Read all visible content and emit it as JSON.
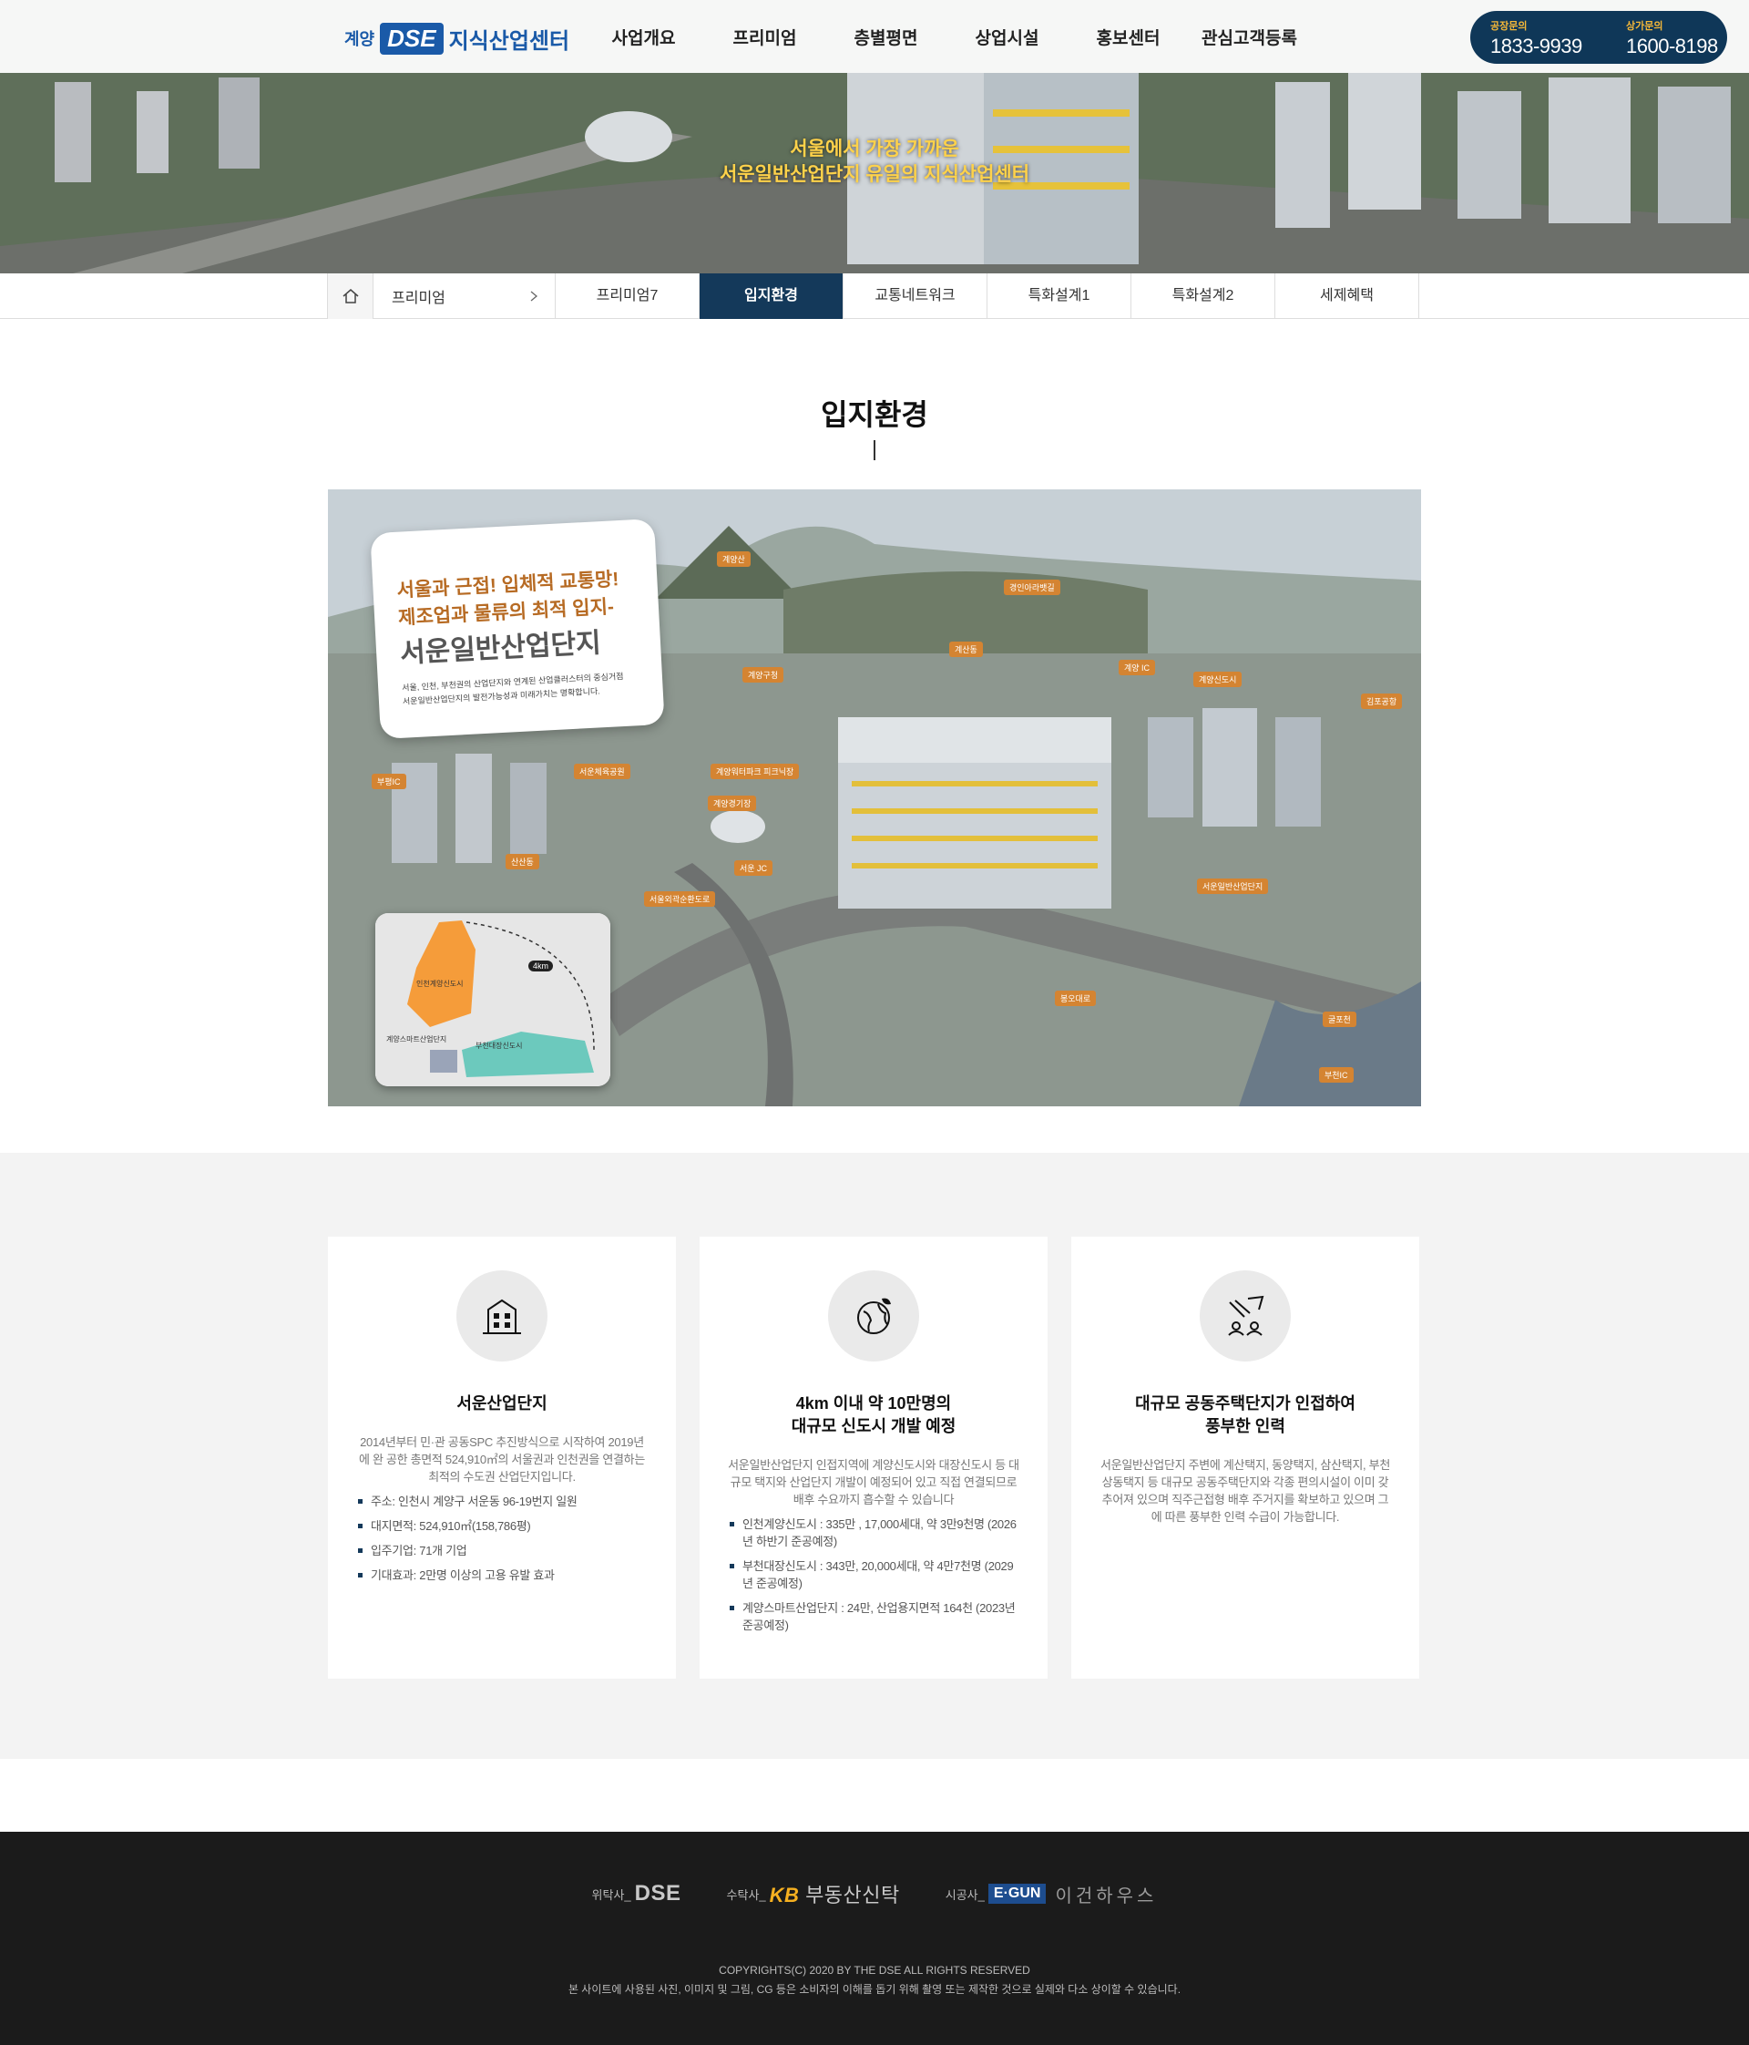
{
  "header": {
    "logo_prefix": "계양",
    "logo_brand": "DSE",
    "logo_name": "지식산업센터",
    "nav": [
      "사업개요",
      "프리미엄",
      "층별평면",
      "상업시설",
      "홍보센터",
      "관심고객등록"
    ],
    "calls": [
      {
        "label": "공장문의",
        "number": "1833-9939"
      },
      {
        "label": "상가문의",
        "number": "1600-8198"
      }
    ],
    "hero_line1": "서울에서 가장 가까운",
    "hero_line2": "서운일반산업단지 유일의 지식산업센터"
  },
  "subnav": {
    "depth1": "프리미엄",
    "tabs": [
      "프리미엄7",
      "입지환경",
      "교통네트워크",
      "특화설계1",
      "특화설계2",
      "세제혜택"
    ],
    "active_index": 1
  },
  "section": {
    "title": "입지환경"
  },
  "map": {
    "card_line1": "서울과 근접! 입체적 교통망!",
    "card_line2": "제조업과 물류의 최적 입지-",
    "card_line3": "서운일반산업단지",
    "card_desc1": "서울, 인천, 부천권의 산업단지와 연계된 산업클러스터의 중심거점",
    "card_desc2": "서운일반산업단지의 발전가능성과 미래가치는 명확합니다.",
    "pins": [
      "계양산",
      "경인아라뱃길",
      "계산동",
      "계양구청",
      "계양 IC",
      "계양신도시",
      "김포공항",
      "부평IC",
      "서운체육공원",
      "계양워터파크 피크닉장",
      "계양경기장",
      "서운 JC",
      "산산동",
      "서울외곽순환도로",
      "서운일반산업단지",
      "봉오대로",
      "굴포천",
      "부천IC"
    ],
    "mini_km": "4km",
    "mini_label1": "인천계양신도시",
    "mini_label2": "계양스마트산업단지",
    "mini_label3": "부천대장신도시"
  },
  "cards": [
    {
      "title_lines": [
        "서운산업단지"
      ],
      "body": "2014년부터 민·관 공동SPC 추진방식으로 시작하여 2019년에 완 공한 총면적 524,910㎡의 서울권과 인천권을 연결하는 최적의 수도권 산업단지입니다.",
      "bullets": [
        "주소: 인천시 계양구 서운동 96-19번지 일원",
        "대지면적: 524,910㎡(158,786평)",
        "입주기업: 71개 기업",
        "기대효과: 2만명 이상의 고용 유발 효과"
      ]
    },
    {
      "title_lines": [
        "4km 이내 약 10만명의",
        "대규모 신도시 개발 예정"
      ],
      "body": "서운일반산업단지 인접지역에 계양신도시와 대장신도시 등 대규모 택지와 산업단지 개발이 예정되어 있고 직접 연결되므로 배후 수요까지 흡수할 수 있습니다",
      "bullets": [
        "인천계양신도시 : 335만 , 17,000세대, 약 3만9천명 (2026년 하반기 준공예정)",
        "부천대장신도시 : 343만, 20,000세대, 약 4만7천명 (2029년 준공예정)",
        "계양스마트산업단지 : 24만, 산업용지면적 164천 (2023년 준공예정)"
      ]
    },
    {
      "title_lines": [
        "대규모 공동주택단지가 인접하여",
        "풍부한 인력"
      ],
      "body": "서운일반산업단지 주변에 계산택지, 동양택지, 삼산택지, 부천 상동택지 등 대규모 공동주택단지와 각종 편의시설이 이미 갖추어져 있으며 직주근접형 배후 주거지를 확보하고 있으며 그에 따른 풍부한 인력 수급이 가능합니다.",
      "bullets": []
    }
  ],
  "footer": {
    "partners": [
      {
        "role": "위탁사_",
        "name": "DSE"
      },
      {
        "role": "수탁사_",
        "mark": "KB",
        "name": "부동산신탁"
      },
      {
        "role": "시공사_",
        "mark": "E·GUN",
        "name": "이건하우스"
      }
    ],
    "copyright": "COPYRIGHTS(C) 2020 BY THE DSE ALL RIGHTS RESERVED",
    "disclaimer": "본 사이트에 사용된 사진, 이미지 및 그림, CG 등은 소비자의 이해를 돕기 위해 촬영 또는 제작한 것으로 실제와 다소 상이할 수 있습니다."
  }
}
